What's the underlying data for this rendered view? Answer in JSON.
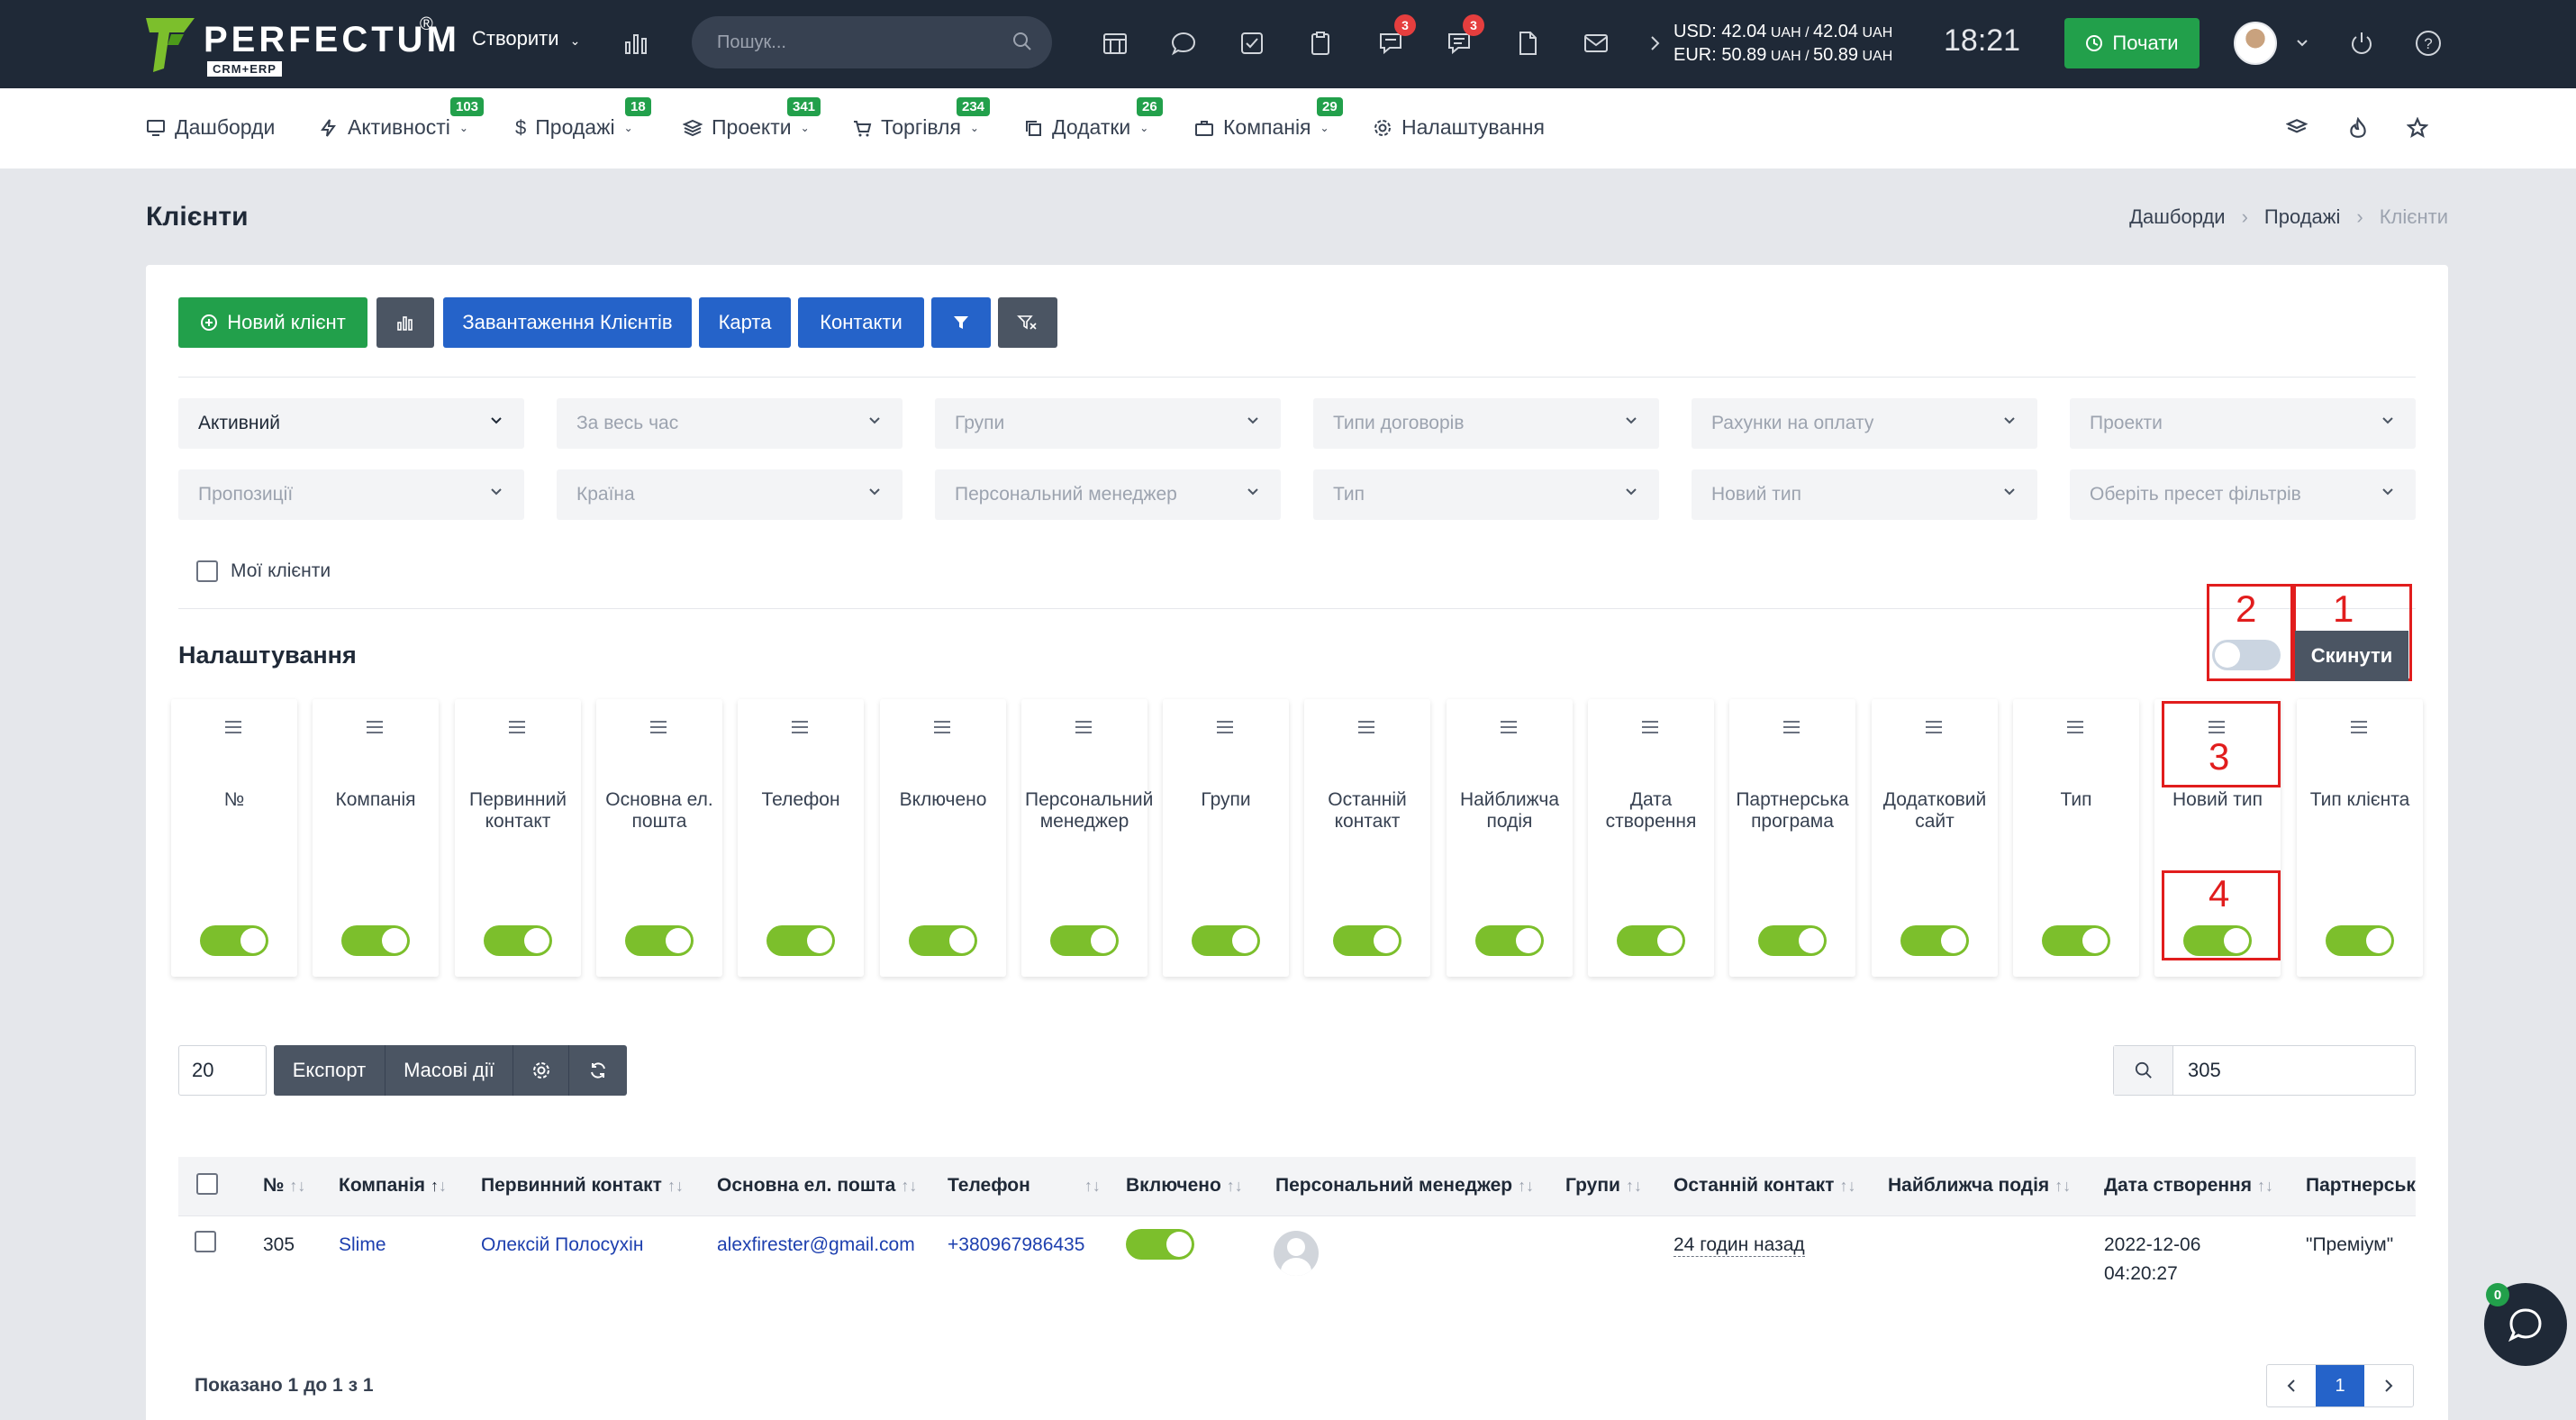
{
  "brand": {
    "name": "PERFECTUM",
    "sub": "CRM+ERP",
    "reg": "®"
  },
  "topbar": {
    "create_label": "Створити",
    "search_placeholder": "Пошук...",
    "badges": {
      "chat": "3",
      "comments": "3"
    },
    "currency": {
      "usd_prefix": "USD: ",
      "usd_val": "42.04",
      "usd_unit": " UAH / ",
      "usd_val2": "42.04",
      "usd_unit2": " UAH",
      "eur_prefix": "EUR: ",
      "eur_val": "50.89",
      "eur_unit": " UAH / ",
      "eur_val2": "50.89",
      "eur_unit2": " UAH"
    },
    "time": "18:21",
    "start_label": "Почати"
  },
  "nav": [
    {
      "label": "Дашборди",
      "badge": ""
    },
    {
      "label": "Активності",
      "badge": "103"
    },
    {
      "label": "Продажі",
      "badge": "18"
    },
    {
      "label": "Проекти",
      "badge": "341"
    },
    {
      "label": "Торгівля",
      "badge": "234"
    },
    {
      "label": "Додатки",
      "badge": "26"
    },
    {
      "label": "Компанія",
      "badge": "29"
    },
    {
      "label": "Налаштування",
      "badge": ""
    }
  ],
  "page": {
    "title": "Клієнти",
    "breadcrumb": [
      "Дашборди",
      "Продажі",
      "Клієнти"
    ]
  },
  "actions": {
    "new_client": "Новий клієнт",
    "upload": "Завантаження Клієнтів",
    "map": "Карта",
    "contacts": "Контакти"
  },
  "filters": {
    "row1": [
      "Активний",
      "За весь час",
      "Групи",
      "Типи договорів",
      "Рахунки на оплату",
      "Проекти"
    ],
    "row2": [
      "Пропозиції",
      "Країна",
      "Персональний менеджер",
      "Тип",
      "Новий тип",
      "Оберіть пресет фільтрів"
    ],
    "my_clients": "Мої клієнти"
  },
  "settings": {
    "title": "Налаштування",
    "reset": "Скинути",
    "annotations": [
      "1",
      "2",
      "3",
      "4"
    ],
    "columns": [
      {
        "label": "№",
        "on": true
      },
      {
        "label": "Компанія",
        "on": true
      },
      {
        "label": "Первинний контакт",
        "on": true
      },
      {
        "label": "Основна ел. пошта",
        "on": true
      },
      {
        "label": "Телефон",
        "on": true
      },
      {
        "label": "Включено",
        "on": true
      },
      {
        "label": "Персональний менеджер",
        "on": true
      },
      {
        "label": "Групи",
        "on": true
      },
      {
        "label": "Останній контакт",
        "on": true
      },
      {
        "label": "Найближча подія",
        "on": true
      },
      {
        "label": "Дата створення",
        "on": true
      },
      {
        "label": "Партнерська програма",
        "on": true
      },
      {
        "label": "Додатковий сайт",
        "on": true
      },
      {
        "label": "Тип",
        "on": true
      },
      {
        "label": "Новий тип",
        "on": true
      },
      {
        "label": "Тип клієнта",
        "on": true
      }
    ]
  },
  "table_controls": {
    "page_size": "20",
    "export": "Експорт",
    "mass": "Масові дії",
    "search_value": "305"
  },
  "table": {
    "headers": [
      "№",
      "Компанія",
      "Первинний контакт",
      "Основна ел. пошта",
      "Телефон",
      "Включено",
      "Персональний менеджер",
      "Групи",
      "Останній контакт",
      "Найближча подія",
      "Дата створення",
      "Партнерськ"
    ],
    "row": {
      "num": "305",
      "company": "Slime",
      "contact": "Олексій Полосухін",
      "email": "alexfirester@gmail.com",
      "phone": "+380967986435",
      "last_contact": "24 годин назад",
      "created_date": "2022-12-06",
      "created_time": "04:20:27",
      "partner": "\"Преміум\""
    }
  },
  "footer": {
    "showing": "Показано 1 до 1 з 1",
    "page": "1"
  },
  "chat": {
    "badge": "0"
  },
  "colors": {
    "accent_green": "#22a04b",
    "accent_blue": "#2563c9",
    "toggle_on": "#7cbf2c",
    "annotation_red": "#e11d1d"
  }
}
